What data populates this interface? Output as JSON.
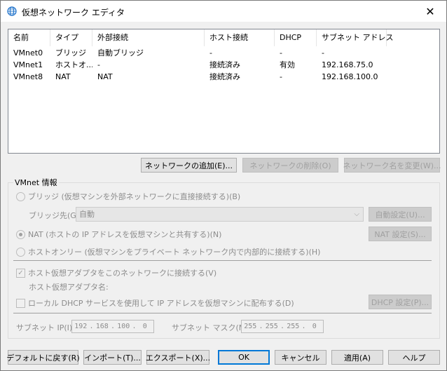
{
  "window": {
    "title": "仮想ネットワーク エディタ",
    "close_glyph": "✕"
  },
  "list": {
    "columns": [
      "名前",
      "タイプ",
      "外部接続",
      "ホスト接続",
      "DHCP",
      "サブネット アドレス"
    ],
    "rows": [
      [
        "VMnet0",
        "ブリッジ",
        "自動ブリッジ",
        "-",
        "-",
        "-"
      ],
      [
        "VMnet1",
        "ホストオ...",
        "-",
        "接続済み",
        "有効",
        "192.168.75.0"
      ],
      [
        "VMnet8",
        "NAT",
        "NAT",
        "接続済み",
        "-",
        "192.168.100.0"
      ]
    ]
  },
  "list_buttons": {
    "add": "ネットワークの追加(E)...",
    "remove": "ネットワークの削除(O)",
    "rename": "ネットワーク名を変更(W)..."
  },
  "info": {
    "title": "VMnet 情報",
    "bridge_label": "ブリッジ (仮想マシンを外部ネットワークに直接接続する)(B)",
    "bridge_to_label": "ブリッジ先(G):",
    "bridge_to_value": "自動",
    "auto_settings": "自動設定(U)...",
    "nat_label": "NAT (ホストの IP アドレスを仮想マシンと共有する)(N)",
    "nat_settings": "NAT 設定(S)...",
    "hostonly_label": "ホストオンリー (仮想マシンをプライベート ネットワーク内で内部的に接続する)(H)",
    "connect_adapter_label": "ホスト仮想アダプタをこのネットワークに接続する(V)",
    "adapter_name_label": "ホスト仮想アダプタ名:",
    "dhcp_label": "ローカル DHCP サービスを使用して IP アドレスを仮想マシンに配布する(D)",
    "dhcp_settings": "DHCP 設定(P)...",
    "subnet_ip_label": "サブネット IP(I):",
    "subnet_ip": [
      "192",
      "168",
      "100",
      "0"
    ],
    "subnet_mask_label": "サブネット マスク(M):",
    "subnet_mask": [
      "255",
      "255",
      "255",
      "0"
    ],
    "dot": "."
  },
  "bottom": {
    "defaults": "デフォルトに戻す(R)",
    "import": "インポート(T)...",
    "export": "エクスポート(X)...",
    "ok": "OK",
    "cancel": "キャンセル",
    "apply": "適用(A)",
    "help": "ヘルプ"
  },
  "colors": {
    "accent": "#0078d7",
    "icon": "#1a6fc9"
  }
}
